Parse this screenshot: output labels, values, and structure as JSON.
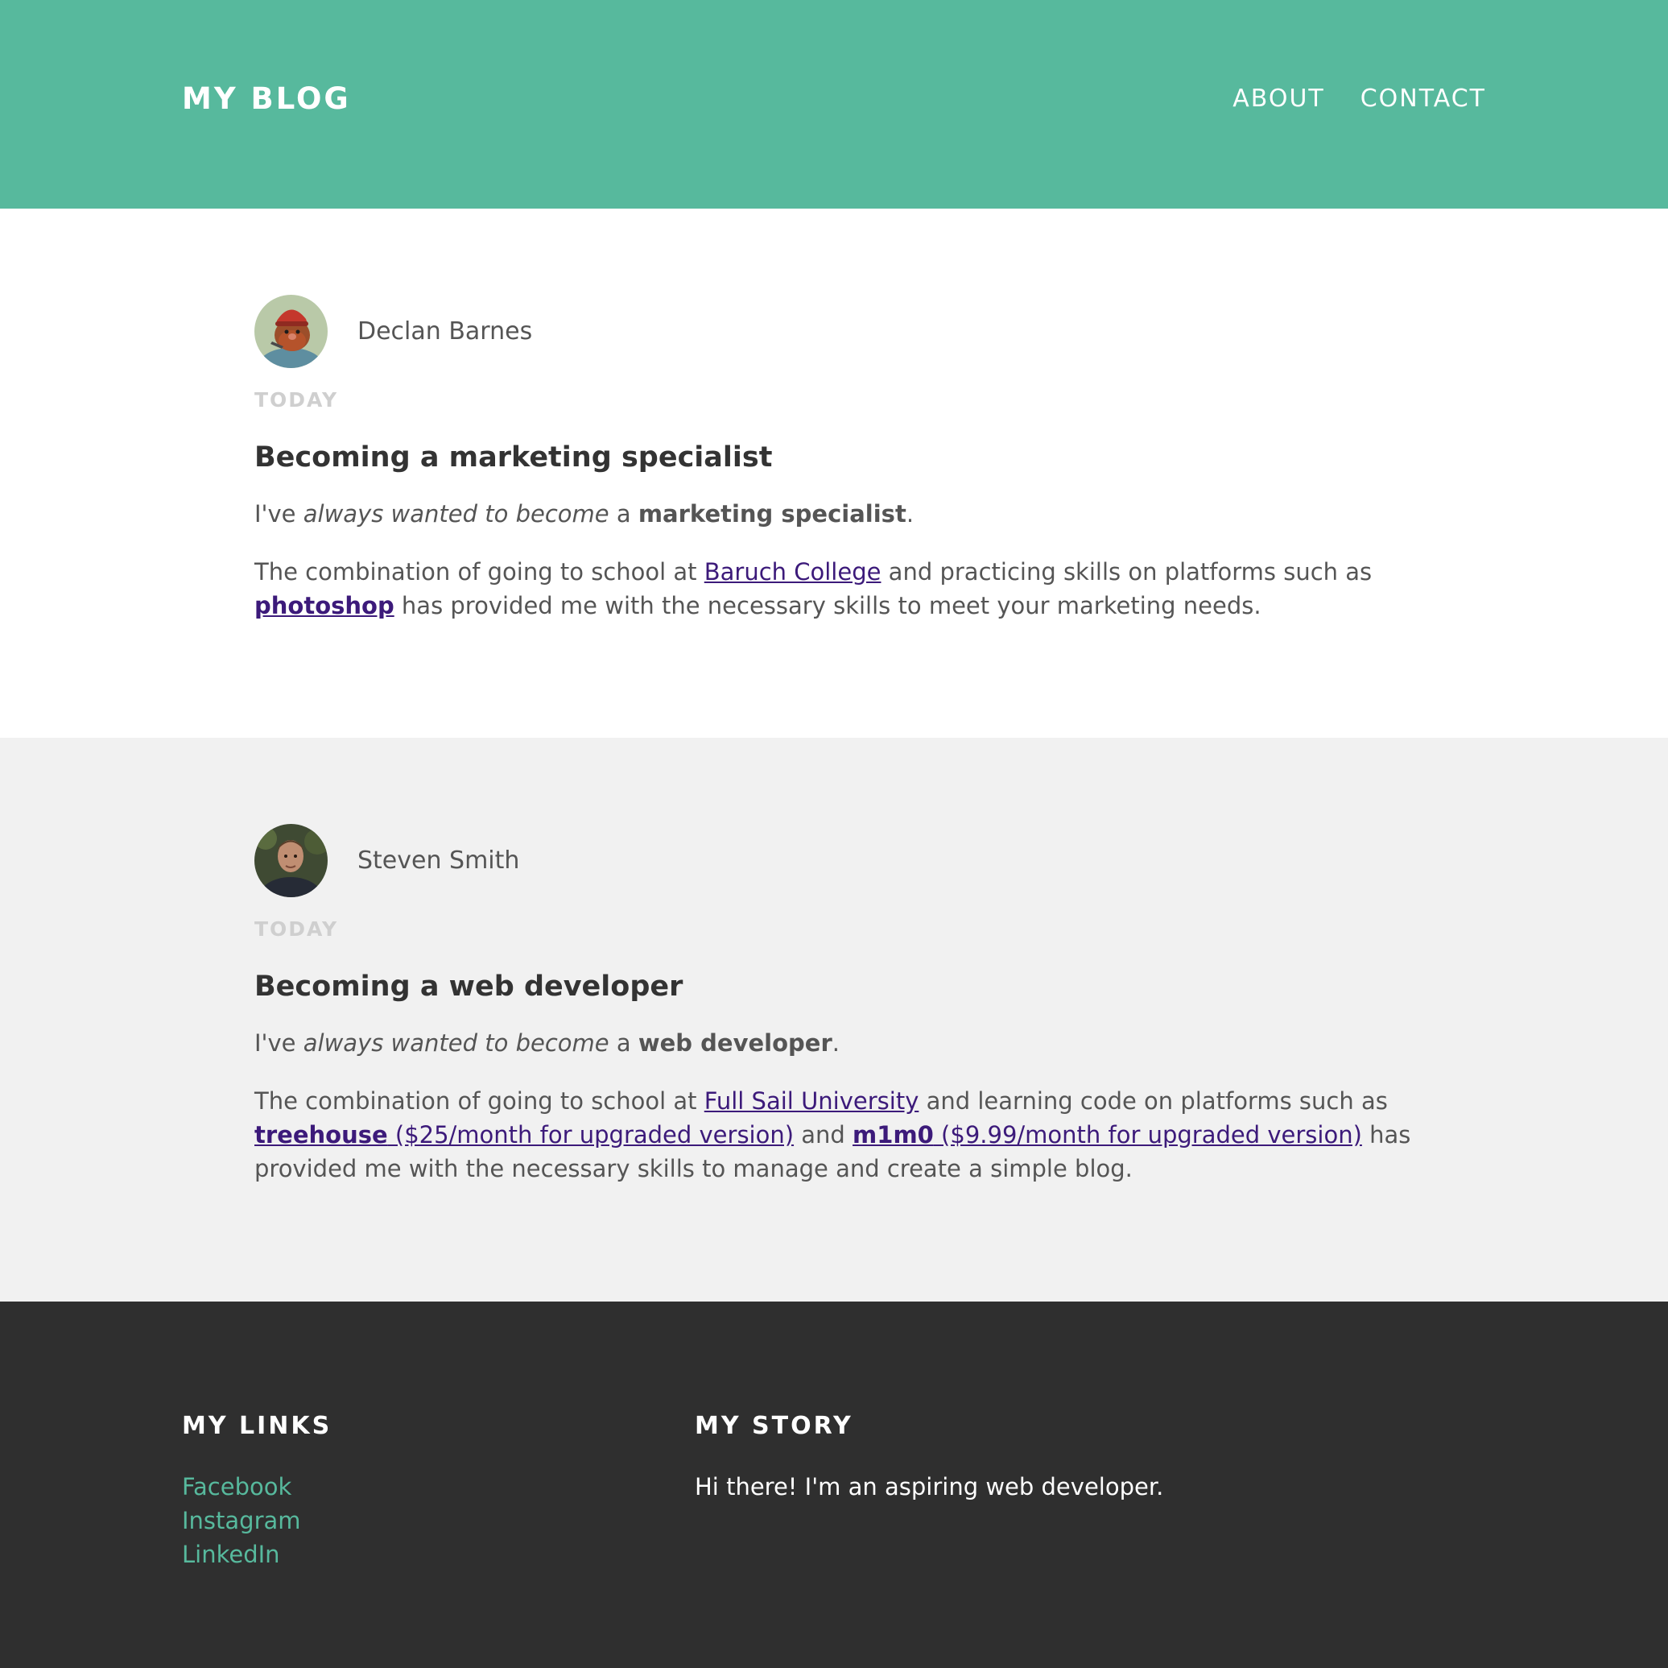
{
  "header": {
    "brand": "MY BLOG",
    "nav": [
      "ABOUT",
      "CONTACT"
    ]
  },
  "posts": [
    {
      "author": "Declan Barnes",
      "date": "TODAY",
      "title": "Becoming a marketing specialist",
      "intro": {
        "a": "I've ",
        "em": "always wanted to become",
        "b": " a ",
        "strong": "marketing specialist",
        "c": "."
      },
      "body": {
        "a": "The combination of going to school at ",
        "link1": "Baruch College",
        "b": " and practicing skills on platforms such as ",
        "link2": "photoshop",
        "c": " has provided me with the necessary skills to meet your marketing needs."
      }
    },
    {
      "author": "Steven Smith",
      "date": "TODAY",
      "title": "Becoming a web developer",
      "intro": {
        "a": "I've ",
        "em": "always wanted to become",
        "b": " a ",
        "strong": "web developer",
        "c": "."
      },
      "body": {
        "a": "The combination of going to school at ",
        "link1": "Full Sail University",
        "b": " and learning code on platforms such as ",
        "link2_bold": "treehouse",
        "link2_rest": " ($25/month for upgraded version)",
        "c": " and ",
        "link3_bold": "m1m0",
        "link3_rest": " ($9.99/month for upgraded version)",
        "d": " has provided me with the necessary skills to manage and create a simple blog."
      }
    }
  ],
  "footer": {
    "links_heading": "MY LINKS",
    "links": [
      "Facebook",
      "Instagram",
      "LinkedIn"
    ],
    "story_heading": "MY STORY",
    "story_text": "Hi there! I'm an aspiring web developer."
  },
  "colors": {
    "header_bg": "#57b99d",
    "post_alt_bg": "#f1f1f1",
    "footer_bg": "#2f2f2f",
    "link": "#3c1a7a",
    "footer_link": "#57b99d"
  }
}
